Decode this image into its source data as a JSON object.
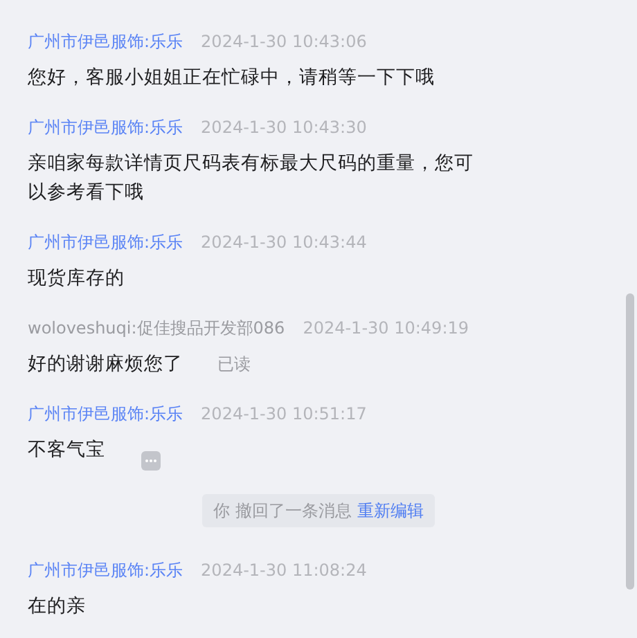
{
  "messages": [
    {
      "kind": "message",
      "sender": "广州市伊邑服饰:乐乐",
      "self": false,
      "time": "2024-1-30 10:43:06",
      "text": "您好，客服小姐姐正在忙碌中，请稍等一下下哦"
    },
    {
      "kind": "message",
      "sender": "广州市伊邑服饰:乐乐",
      "self": false,
      "time": "2024-1-30 10:43:30",
      "text": "亲咱家每款详情页尺码表有标最大尺码的重量，您可以参考看下哦"
    },
    {
      "kind": "message",
      "sender": "广州市伊邑服饰:乐乐",
      "self": false,
      "time": "2024-1-30 10:43:44",
      "text": "现货库存的"
    },
    {
      "kind": "message",
      "sender": "woloveshuqi:促佳搜品开发部086",
      "self": true,
      "time": "2024-1-30 10:49:19",
      "text": "好的谢谢麻烦您了",
      "status": "已读"
    },
    {
      "kind": "message",
      "sender": "广州市伊邑服饰:乐乐",
      "self": false,
      "time": "2024-1-30 10:51:17",
      "text": "不客气宝",
      "more_button": true
    },
    {
      "kind": "recall",
      "text": "你 撤回了一条消息",
      "link": "重新编辑"
    },
    {
      "kind": "message",
      "sender": "广州市伊邑服饰:乐乐",
      "self": false,
      "time": "2024-1-30 11:08:24",
      "text": "在的亲"
    }
  ]
}
